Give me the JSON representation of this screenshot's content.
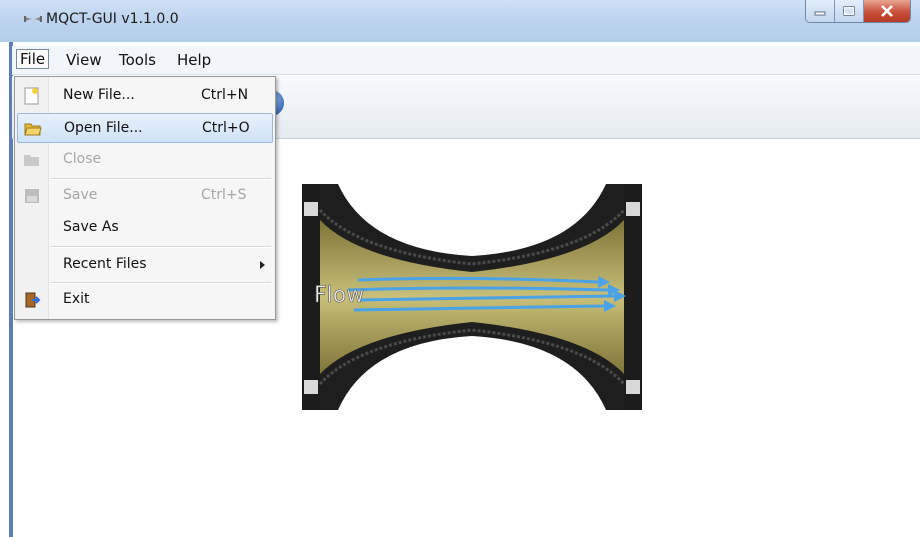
{
  "window": {
    "title": "MQCT-GUI v1.1.0.0",
    "controls": {
      "minimize": "minimize",
      "maximize": "maximize",
      "close": "close"
    }
  },
  "menubar": {
    "items": [
      "File",
      "View",
      "Tools",
      "Help"
    ],
    "open_menu": "File"
  },
  "file_menu": {
    "items": [
      {
        "label": "New File...",
        "shortcut": "Ctrl+N",
        "icon": "new-file-icon",
        "enabled": true
      },
      {
        "label": "Open File...",
        "shortcut": "Ctrl+O",
        "icon": "open-folder-icon",
        "enabled": true,
        "highlighted": true
      },
      {
        "label": "Close",
        "shortcut": "",
        "icon": "folder-icon",
        "enabled": false
      },
      {
        "label": "Save",
        "shortcut": "Ctrl+S",
        "icon": "save-icon",
        "enabled": false
      },
      {
        "label": "Save As",
        "shortcut": "",
        "icon": "",
        "enabled": true
      },
      {
        "label": "Recent Files",
        "shortcut": "",
        "icon": "submenu-arrow-icon",
        "enabled": true,
        "has_submenu": true
      },
      {
        "label": "Exit",
        "shortcut": "",
        "icon": "exit-door-icon",
        "enabled": true
      }
    ]
  },
  "canvas": {
    "diagram_label": "Flow"
  },
  "colors": {
    "titlebar": "#bcd3ee",
    "highlight": "#cfe2f7",
    "pipe_brass": "#a9a05a",
    "pipe_dark": "#1e1e1e",
    "flow_arrows": "#4aa3e6"
  }
}
